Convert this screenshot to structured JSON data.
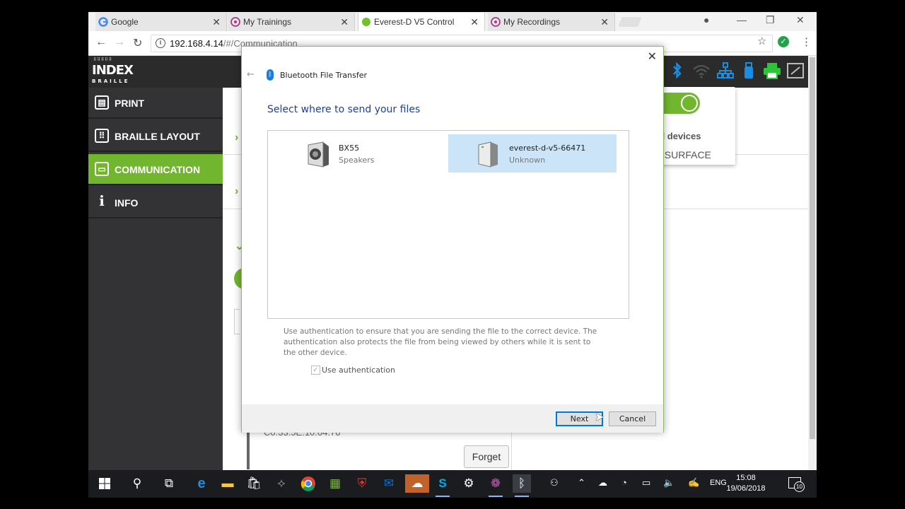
{
  "browser": {
    "tabs": [
      {
        "label": "Google",
        "icon": "google-icon"
      },
      {
        "label": "My Trainings",
        "icon": "trainings-icon"
      },
      {
        "label": "Everest-D V5 Control",
        "icon": "green-dot-icon",
        "active": true
      },
      {
        "label": "My Recordings",
        "icon": "recordings-icon"
      }
    ],
    "tab_close": "✕",
    "url_host": "192.168.4.14",
    "url_path": "/#/Communication"
  },
  "app": {
    "logo_top": "INDEX",
    "logo_bottom": "BRAILLE",
    "sidebar": [
      {
        "label": "PRINT",
        "icon": "printer-icon"
      },
      {
        "label": "BRAILLE LAYOUT",
        "icon": "layout-icon"
      },
      {
        "label": "COMMUNICATION",
        "icon": "chat-icon",
        "active": true
      },
      {
        "label": "INFO",
        "icon": "info-icon"
      }
    ],
    "bt_popover": {
      "toggle_label": "ON",
      "paired_label": "ed devices",
      "device": "N-SURFACE"
    },
    "mac_address": "C0:33:5E:10:04:70",
    "forget_label": "Forget",
    "accent": "#72b52f"
  },
  "dialog": {
    "title": "Bluetooth File Transfer",
    "heading": "Select where to send your files",
    "devices": [
      {
        "name": "BX55",
        "type": "Speakers"
      },
      {
        "name": "everest-d-v5-66471",
        "type": "Unknown",
        "selected": true
      }
    ],
    "auth_text": "Use authentication to ensure that you are sending the file to the correct device. The authentication also protects the file from being viewed by others while it is sent to the other device.",
    "auth_label": "Use authentication",
    "next_label": "Next",
    "cancel_label": "Cancel"
  },
  "taskbar": {
    "language": "ENG",
    "time": "15:08",
    "date": "19/06/2018",
    "notifications": "10"
  }
}
